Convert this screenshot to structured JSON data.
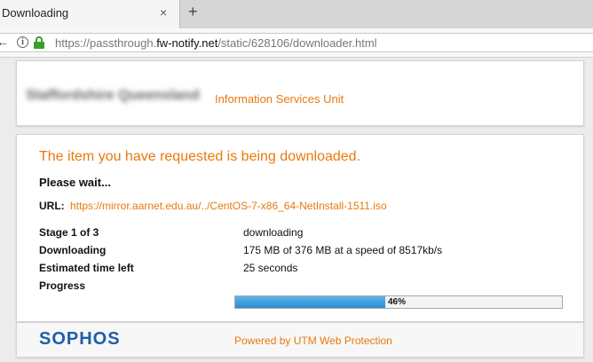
{
  "browser": {
    "tab_title": "Downloading",
    "tab_close": "×",
    "new_tab": "+",
    "url_prefix": "https://passthrough.",
    "url_domain": "fw-notify.net",
    "url_suffix": "/static/628106/downloader.html"
  },
  "header": {
    "org_name": "Staffordshire Queensland",
    "unit_name": "Information Services Unit"
  },
  "download": {
    "title": "The item you have requested is being downloaded.",
    "wait": "Please wait...",
    "url_label": "URL:",
    "url_value": "https://mirror.aarnet.edu.au/../CentOS-7-x86_64-NetInstall-1511.iso",
    "rows": [
      {
        "label": "Stage 1 of 3",
        "value": "downloading"
      },
      {
        "label": "Downloading",
        "value": "175 MB of 376 MB at a speed of 8517kb/s"
      },
      {
        "label": "Estimated time left",
        "value": "25 seconds"
      },
      {
        "label": "Progress",
        "value": ""
      }
    ],
    "progress_percent": 46,
    "progress_label": "46%"
  },
  "footer": {
    "brand": "SOPHOS",
    "powered_by": "Powered by UTM Web Protection"
  },
  "colors": {
    "accent": "#e8790f",
    "brand": "#1e5ea9",
    "progress": "#2b8bd0"
  }
}
